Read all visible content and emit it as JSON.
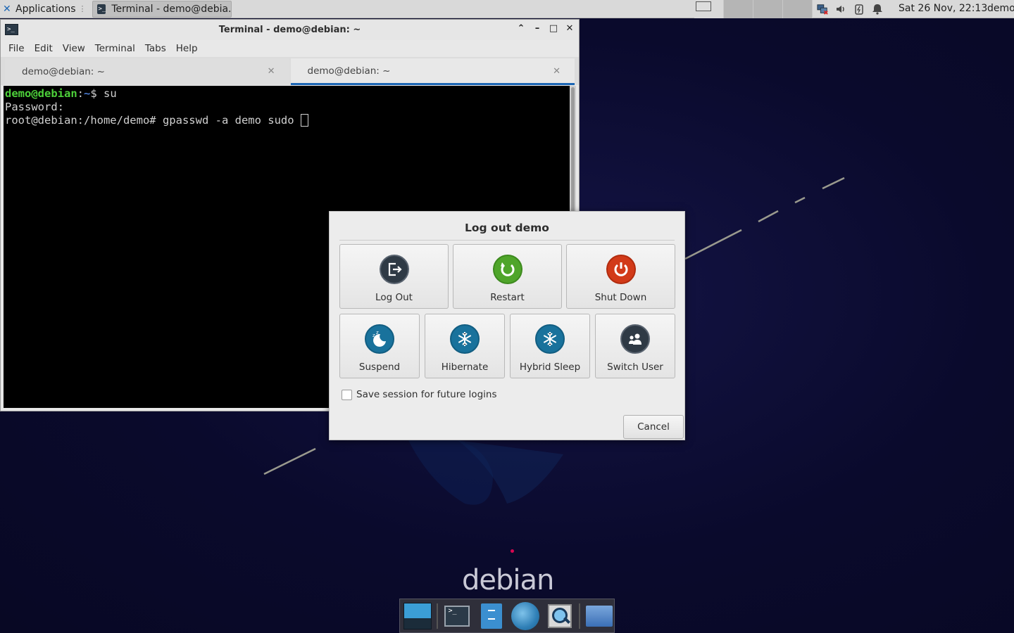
{
  "top_panel": {
    "applications_label": "Applications",
    "task_title": "Terminal - demo@debia...",
    "clock": "Sat 26 Nov, 22:13",
    "user": "demo"
  },
  "terminal": {
    "title": "Terminal - demo@debian: ~",
    "menu": [
      "File",
      "Edit",
      "View",
      "Terminal",
      "Tabs",
      "Help"
    ],
    "tabs": [
      {
        "label": "demo@debian: ~",
        "active": false
      },
      {
        "label": "demo@debian: ~",
        "active": true
      }
    ],
    "lines": {
      "line1_user": "demo@debian",
      "line1_sep": ":",
      "line1_path": "~",
      "line1_cmd": "$ su",
      "line2": "Password:",
      "line3": "root@debian:/home/demo# gpasswd -a demo sudo "
    }
  },
  "logout_dialog": {
    "title": "Log out demo",
    "actions": [
      {
        "label": "Log Out",
        "icon": "logout-icon"
      },
      {
        "label": "Restart",
        "icon": "restart-icon"
      },
      {
        "label": "Shut Down",
        "icon": "power-icon"
      },
      {
        "label": "Suspend",
        "icon": "suspend-icon"
      },
      {
        "label": "Hibernate",
        "icon": "snowflake-icon"
      },
      {
        "label": "Hybrid Sleep",
        "icon": "snowflake-icon"
      },
      {
        "label": "Switch User",
        "icon": "users-icon"
      }
    ],
    "save_session_label": "Save session for future logins",
    "save_session_checked": false,
    "cancel_label": "Cancel"
  },
  "desktop": {
    "logo_text": "debian"
  },
  "colors": {
    "accent": "#1c66b4",
    "restart": "#4fa52a",
    "shutdown": "#d23a19",
    "sleep": "#19729c",
    "dark": "#2f3a45"
  }
}
